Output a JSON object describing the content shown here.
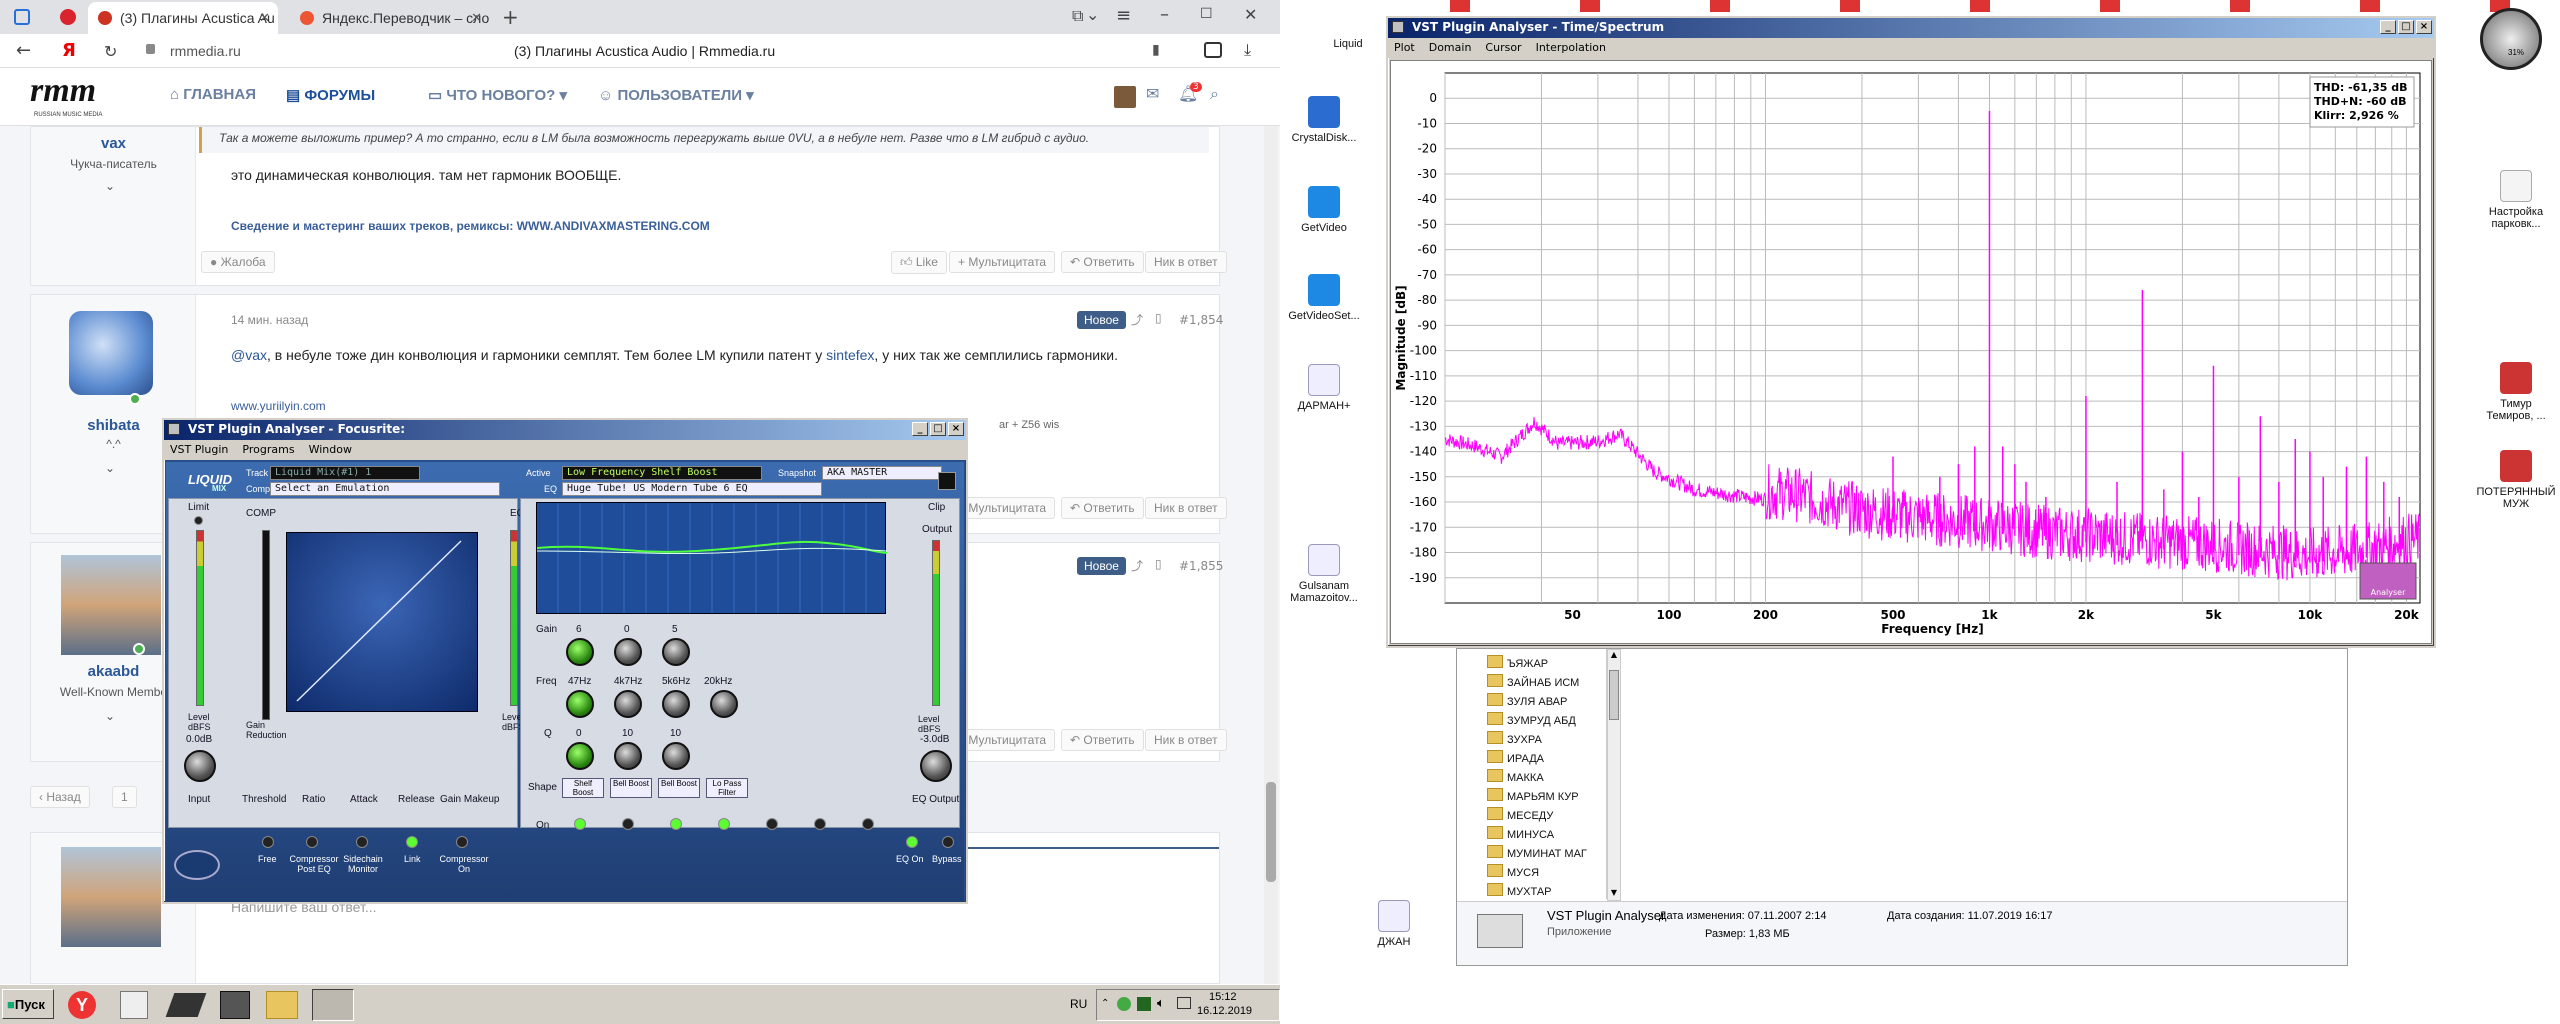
{
  "browser": {
    "tabs": [
      {
        "label": "(3) Плагины Acustica Au",
        "active": true
      },
      {
        "label": "Яндекс.Переводчик – сло",
        "active": false
      }
    ],
    "url": "rmmedia.ru",
    "page_title": "(3) Плагины Acustica Audio | Rmmedia.ru",
    "site": {
      "logo": "rmm",
      "logo_sub": "RUSSIAN MUSIC MEDIA",
      "nav": [
        {
          "label": "ГЛАВНАЯ"
        },
        {
          "label": "ФОРУМЫ"
        },
        {
          "label": "ЧТО НОВОГО?"
        },
        {
          "label": "ПОЛЬЗОВАТЕЛИ"
        }
      ],
      "notif_count": "3"
    },
    "posts": [
      {
        "user": "vax",
        "user_title": "Чукча-писатель",
        "quote": "Так а можете выложить пример? А то странно, если в LM была возможность перегружать выше 0VU, а в небуле нет. Разве что в LM гибрид с аудио.",
        "text": "это динамическая конволюция. там нет гармоник ВООБЩЕ.",
        "signature": "Сведение и мастеринг ваших треков, ремиксы: WWW.ANDIVAXMASTERING.COM",
        "report": "Жалоба",
        "like": "Like",
        "multiquote": "Мультицитата",
        "reply": "Ответить",
        "reply_to": "Ник в ответ"
      },
      {
        "user": "shibata",
        "user_title": "^.^",
        "time": "14 мин. назад",
        "badge": "Новое",
        "num": "#1,854",
        "mention": "@vax",
        "text_a": ", в небуле тоже дин конволюция и гармоники семплят. Тем более LM купили патент у ",
        "link": "sintefex",
        "text_b": ", у них так же семплились гармоники.",
        "signature": "www.yuriilyin.com",
        "sig_extra": "ar + Z56 wis"
      },
      {
        "user": "akaabd",
        "user_title": "Well-Known Membe",
        "badge": "Новое",
        "num": "#1,855"
      }
    ],
    "pagination": {
      "prev": "Назад",
      "page": "1"
    },
    "reply_placeholder": "Напишите ваш ответ..."
  },
  "taskbar": {
    "start": "Пуск",
    "lang": "RU",
    "time": "15:12",
    "date": "16.12.2019"
  },
  "desktop_icons": [
    {
      "label": "Liquid"
    },
    {
      "label": "CrystalDisk..."
    },
    {
      "label": "GetVideo"
    },
    {
      "label": "GetVideoSet..."
    },
    {
      "label": "ДАРМАН+"
    },
    {
      "label": "Gulsanam Mamazoitov..."
    },
    {
      "label": "ДЖАН"
    },
    {
      "label": "Настройка парковк..."
    },
    {
      "label": "Тимур Темиров, ..."
    },
    {
      "label": "ПОТЕРЯННЫЙ МУЖ"
    }
  ],
  "file_explorer": {
    "folders": [
      "ЪЯЖАР",
      "ЗАЙНАБ ИСМ",
      "ЗУЛЯ АВАР",
      "ЗУМРУД АБД",
      "ЗУХРА",
      "ИРАДА",
      "МАККА",
      "МАРЬЯМ КУР",
      "МЕСЕДУ",
      "МИНУСА",
      "МУМИНАТ МАГ",
      "МУСЯ",
      "МУХТАР"
    ],
    "file_name": "VST Plugin Analyser",
    "file_type": "Приложение",
    "modified": "Дата изменения: 07.11.2007 2:14",
    "created": "Дата создания: 11.07.2019 16:17",
    "size": "Размер: 1,83 МБ"
  },
  "analyser": {
    "title": "VST Plugin Analyser - Time/Spectrum",
    "menu": [
      "Plot",
      "Domain",
      "Cursor",
      "Interpolation"
    ],
    "readout": [
      "THD: -61,35 dB",
      "THD+N: -60 dB",
      "Klirr: 2,926 %"
    ],
    "logo": "Analyser",
    "gauge_label": "31%",
    "chart_data": {
      "type": "line",
      "xlabel": "Frequency [Hz]",
      "ylabel": "Magnitude [dB]",
      "x_scale": "log",
      "xlim": [
        20,
        22050
      ],
      "ylim": [
        -200,
        10
      ],
      "grid": true,
      "x_ticks": [
        {
          "v": 50,
          "l": "50"
        },
        {
          "v": 100,
          "l": "100"
        },
        {
          "v": 200,
          "l": "200"
        },
        {
          "v": 500,
          "l": "500"
        },
        {
          "v": 1000,
          "l": "1k"
        },
        {
          "v": 2000,
          "l": "2k"
        },
        {
          "v": 5000,
          "l": "5k"
        },
        {
          "v": 10000,
          "l": "10k"
        },
        {
          "v": 20000,
          "l": "20k"
        }
      ],
      "y_ticks": [
        0,
        -10,
        -20,
        -30,
        -40,
        -50,
        -60,
        -70,
        -80,
        -90,
        -100,
        -110,
        -120,
        -130,
        -140,
        -150,
        -160,
        -170,
        -180,
        -190
      ],
      "series": [
        {
          "color": "#ff00ff",
          "noise_floor": [
            [
              20,
              -135
            ],
            [
              25,
              -138
            ],
            [
              30,
              -142
            ],
            [
              38,
              -128
            ],
            [
              45,
              -137
            ],
            [
              60,
              -136
            ],
            [
              70,
              -133
            ],
            [
              90,
              -148
            ],
            [
              120,
              -155
            ],
            [
              170,
              -158
            ],
            [
              250,
              -160
            ],
            [
              350,
              -165
            ],
            [
              500,
              -168
            ],
            [
              700,
              -170
            ],
            [
              1000,
              -172
            ],
            [
              1500,
              -175
            ],
            [
              2000,
              -176
            ],
            [
              3000,
              -178
            ],
            [
              5000,
              -180
            ],
            [
              7000,
              -182
            ],
            [
              10000,
              -184
            ],
            [
              15000,
              -182
            ],
            [
              20000,
              -178
            ]
          ],
          "peaks": [
            [
              1000,
              -5
            ],
            [
              2000,
              -118
            ],
            [
              3000,
              -76
            ],
            [
              4000,
              -140
            ],
            [
              5000,
              -106
            ],
            [
              6000,
              -150
            ],
            [
              7000,
              -126
            ],
            [
              8000,
              -152
            ],
            [
              9000,
              -135
            ],
            [
              10000,
              -140
            ],
            [
              11000,
              -150
            ],
            [
              13000,
              -146
            ],
            [
              15000,
              -142
            ],
            [
              17000,
              -152
            ],
            [
              19000,
              -158
            ],
            [
              500,
              -142
            ],
            [
              700,
              -150
            ],
            [
              800,
              -145
            ],
            [
              900,
              -138
            ],
            [
              1100,
              -138
            ],
            [
              1200,
              -145
            ],
            [
              1300,
              -152
            ],
            [
              1500,
              -158
            ],
            [
              2500,
              -152
            ],
            [
              3500,
              -155
            ],
            [
              4500,
              -158
            ]
          ]
        }
      ]
    }
  },
  "vstfx": {
    "title": "VST Plugin Analyser - Focusrite:",
    "menu": [
      "VST Plugin",
      "Programs",
      "Window"
    ],
    "brand": "LIQUID",
    "brand_sub": "MIX",
    "track_label": "Track",
    "track_value": "Liquid Mix(#1) 1",
    "comp_label": "Comp",
    "comp_value": "Select an Emulation",
    "active_label": "Active",
    "active_value": "Low Frequency Shelf Boost",
    "snapshot_label": "Snapshot",
    "snapshot_value": "AKA MASTER",
    "eq_label": "EQ",
    "eq_value": "Huge Tube! US Modern Tube 6 EQ",
    "sections": {
      "limit": "Limit",
      "comp": "COMP",
      "eq": "EQ",
      "clip": "Clip",
      "output": "Output"
    },
    "input_db": "0.0dB",
    "output_db": "-3.0dB",
    "meter_labels": {
      "level": "Level dBFS",
      "gain_reduction": "Gain Reduction"
    },
    "comp_controls": [
      "Input",
      "Threshold",
      "Ratio",
      "Attack",
      "Release",
      "Gain Makeup"
    ],
    "eq_gain_label": "Gain",
    "eq_freq_label": "Freq",
    "eq_q_label": "Q",
    "eq_shape_label": "Shape",
    "eq_on_label": "On",
    "eq_gains": [
      "6",
      "0",
      "5"
    ],
    "eq_freqs": [
      "47Hz",
      "4k7Hz",
      "5k6Hz",
      "20kHz"
    ],
    "eq_qs": [
      "0",
      "10",
      "10"
    ],
    "eq_shapes": [
      "Shelf Boost",
      "Bell Boost",
      "Bell Boost",
      "Lo Pass Filter"
    ],
    "eq_output": "EQ Output",
    "bottom": [
      "Free",
      "Compressor Post EQ",
      "Sidechain Monitor",
      "Link",
      "Compressor On",
      "EQ On",
      "Bypass"
    ]
  }
}
